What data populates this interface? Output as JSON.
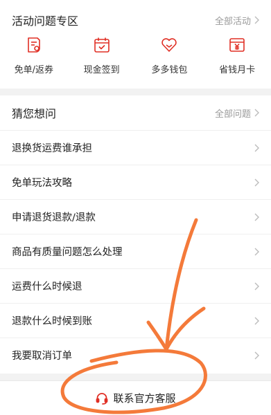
{
  "activity": {
    "title": "活动问题专区",
    "more": "全部活动",
    "items": [
      {
        "label": "免单/返券",
        "icon": "coupon-icon"
      },
      {
        "label": "现金签到",
        "icon": "calendar-check-icon"
      },
      {
        "label": "多多钱包",
        "icon": "heart-wallet-icon"
      },
      {
        "label": "省钱月卡",
        "icon": "yen-card-icon"
      }
    ]
  },
  "faq": {
    "title": "猜您想问",
    "more": "全部问题",
    "items": [
      {
        "label": "退换货运费谁承担"
      },
      {
        "label": "免单玩法攻略"
      },
      {
        "label": "申请退货退款/退款"
      },
      {
        "label": "商品有质量问题怎么处理"
      },
      {
        "label": "运费什么时候退"
      },
      {
        "label": "退款什么时候到账"
      },
      {
        "label": "我要取消订单"
      }
    ]
  },
  "service": {
    "label": "联系官方客服",
    "icon": "headset-icon"
  },
  "colors": {
    "accent": "#e02e24",
    "annotation": "#f47a3a",
    "chevron": "#bbbbbb"
  }
}
